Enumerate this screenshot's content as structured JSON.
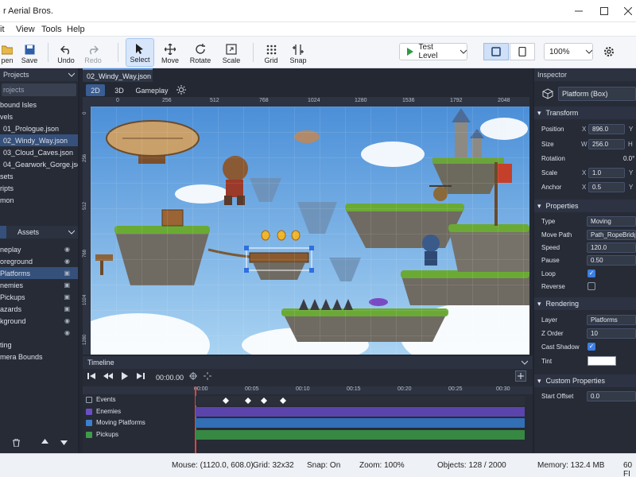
{
  "app": {
    "title": "r Aerial Bros."
  },
  "menu": [
    "it",
    "View",
    "Tools",
    "Help"
  ],
  "toolbar": {
    "open": "pen",
    "save": "Save",
    "undo": "Undo",
    "redo": "Redo",
    "select": "Select",
    "move": "Move",
    "rotate": "Rotate",
    "scale": "Scale",
    "grid": "Grid",
    "snap": "Snap",
    "test_level": "Test Level",
    "zoom": "100%"
  },
  "projects": {
    "header": "Projects",
    "search": "rojects",
    "items": [
      "bound Isles",
      "vels",
      "01_Prologue.json",
      "02_Windy_Way.json",
      "03_Cloud_Caves.json",
      "04_Gearwork_Gorge.json",
      "sets",
      "ripts",
      "mon"
    ]
  },
  "layers_tabs": {
    "layers": "",
    "assets": "Assets"
  },
  "layers": [
    "neplay",
    "oreground",
    "Platforms",
    "nemies",
    "Pickups",
    "azards",
    "kground",
    "",
    "ting",
    "mera Bounds"
  ],
  "document": {
    "tab": "02_Windy_Way.json"
  },
  "view_tabs": {
    "mode2d": "2D",
    "mode3d": "3D",
    "gameplay": "Gameplay"
  },
  "ruler": [
    "0",
    "256",
    "512",
    "768",
    "1024",
    "1280",
    "1536",
    "1792",
    "2048"
  ],
  "vruler": [
    "0",
    "256",
    "512",
    "768",
    "1024",
    "1280"
  ],
  "timeline": {
    "header": "Timeline",
    "time": "00:00.00",
    "ticks": [
      "00:00",
      "00:05",
      "00:10",
      "00:15",
      "00:20",
      "00:25",
      "00:30"
    ],
    "tracks": [
      {
        "name": "Events",
        "color": "#3b3f4a"
      },
      {
        "name": "Enemies",
        "color": "#6a4fc4"
      },
      {
        "name": "Moving Platforms",
        "color": "#3b7fcf"
      },
      {
        "name": "Pickups",
        "color": "#3f9a4a"
      }
    ]
  },
  "inspector": {
    "header": "Inspector",
    "object": "Platform (Box)",
    "transform": {
      "title": "Transform",
      "position_label": "Position",
      "position_x": "896.0",
      "size_label": "Size",
      "size_w": "256.0",
      "rotation_label": "Rotation",
      "rotation": "0.0°",
      "scale_label": "Scale",
      "scale_x": "1.0",
      "anchor_label": "Anchor",
      "anchor_x": "0.5",
      "ax_x": "X",
      "ax_y": "Y",
      "ax_w": "W",
      "ax_h": "H"
    },
    "properties": {
      "title": "Properties",
      "type_label": "Type",
      "type": "Moving",
      "path_label": "Move Path",
      "path": "Path_RopeBridge",
      "speed_label": "Speed",
      "speed": "120.0",
      "pause_label": "Pause",
      "pause": "0.50",
      "loop_label": "Loop",
      "loop": true,
      "reverse_label": "Reverse",
      "reverse": false
    },
    "rendering": {
      "title": "Rendering",
      "layer_label": "Layer",
      "layer": "Platforms",
      "zorder_label": "Z Order",
      "zorder": "10",
      "shadow_label": "Cast Shadow",
      "shadow": true,
      "tint_label": "Tint",
      "tint": "#ffffff"
    },
    "custom": {
      "title": "Custom Properties",
      "start_label": "Start Offset",
      "start": "0.0"
    }
  },
  "status": {
    "mouse": "Mouse: (1120.0, 608.0)",
    "grid": "Grid: 32x32",
    "snap": "Snap: On",
    "zoom": "Zoom: 100%",
    "objects": "Objects: 128 / 2000",
    "memory": "Memory: 132.4 MB",
    "fps": "60 FI"
  }
}
